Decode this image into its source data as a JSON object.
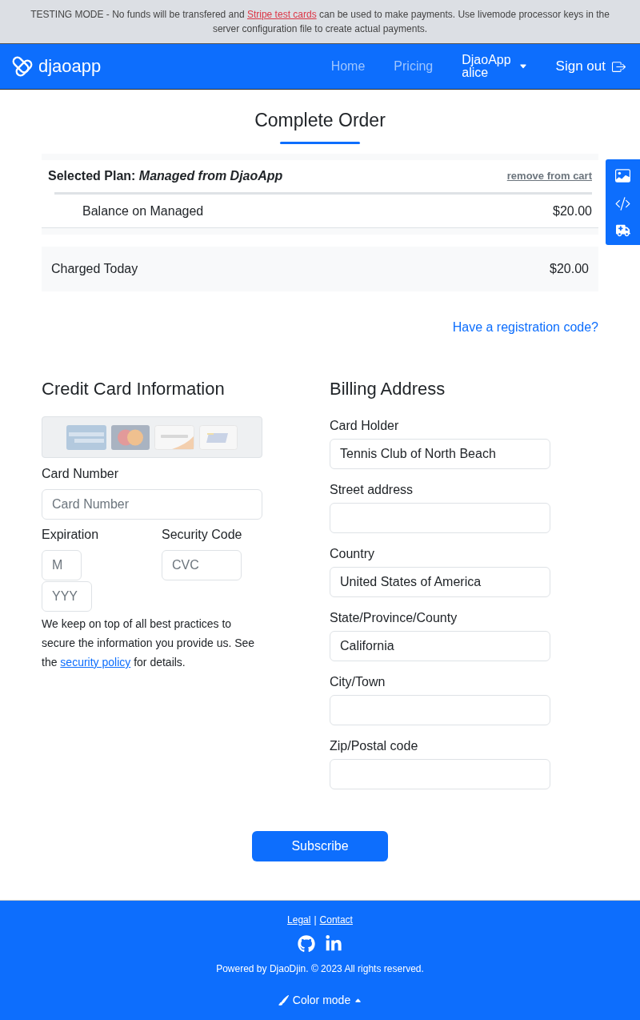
{
  "test_banner": {
    "text_before": "TESTING MODE - No funds will be transfered and",
    "link": "Stripe test cards",
    "text_after": "can be used to make payments. Use livemode processor keys in the server configuration file to create actual payments."
  },
  "navbar": {
    "brand": "djaoapp",
    "links": [
      "Home",
      "Pricing"
    ],
    "user_menu": {
      "organization": "DjaoApp",
      "username": "alice"
    },
    "sign_out": "Sign out"
  },
  "page_title": "Complete Order",
  "cart": {
    "plan": "Selected Plan: *Managed from DjaoApp*",
    "remove_link": "remove from cart",
    "lines": [
      {
        "description": "Balance on Managed",
        "amount": "$20.00"
      }
    ]
  },
  "total": {
    "label": "Charged Today",
    "amount": "$20.00"
  },
  "registration_link": "Have a registration code?",
  "credit_card": {
    "heading": "Credit Card Information",
    "card_number": {
      "label": "Card Number",
      "placeholder": "Card Number"
    },
    "expiration": {
      "label": "Expiration",
      "month_placeholder": "M",
      "year_placeholder": "YYY"
    },
    "security_code": {
      "label": "Security Code",
      "placeholder": "CVC"
    },
    "note": {
      "before": "We keep on top of all best practices to secure the information you provide us. See the",
      "link": "security policy",
      "after": "for details."
    }
  },
  "billing_address": {
    "heading": "Billing Address",
    "fields": [
      {
        "label": "Card Holder",
        "value": "Tennis Club of North Beach"
      },
      {
        "label": "Street address"
      },
      {
        "label": "Country",
        "value": "United States of America"
      },
      {
        "label": "State/Province/County",
        "value": "California"
      },
      {
        "label": "City/Town"
      },
      {
        "label": "Zip/Postal code"
      }
    ]
  },
  "subscribe_button": "Subscribe",
  "footer": {
    "links": [
      "Legal",
      "Contact"
    ],
    "separator": "|",
    "copyright": "Powered by DjaoDjin. © 2023 All rights reserved.",
    "color_mode": "Color mode"
  }
}
